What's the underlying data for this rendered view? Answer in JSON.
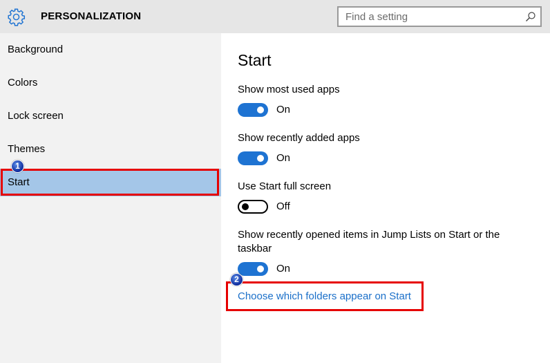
{
  "header": {
    "title": "PERSONALIZATION",
    "icon": "gear-icon",
    "search": {
      "placeholder": "Find a setting",
      "value": "",
      "icon": "search-icon"
    }
  },
  "sidebar": {
    "items": [
      {
        "label": "Background",
        "selected": false
      },
      {
        "label": "Colors",
        "selected": false
      },
      {
        "label": "Lock screen",
        "selected": false
      },
      {
        "label": "Themes",
        "selected": false
      },
      {
        "label": "Start",
        "selected": true
      }
    ],
    "selected_color": "#a4c6e8"
  },
  "main": {
    "title": "Start",
    "settings": [
      {
        "label": "Show most used apps",
        "state": "On",
        "on": true
      },
      {
        "label": "Show recently added apps",
        "state": "On",
        "on": true
      },
      {
        "label": "Use Start full screen",
        "state": "Off",
        "on": false
      },
      {
        "label": "Show recently opened items in Jump Lists on Start or the taskbar",
        "state": "On",
        "on": true
      }
    ],
    "link": "Choose which folders appear on Start",
    "accent_color": "#1e73d2"
  },
  "annotations": {
    "badge1": "1",
    "badge2": "2",
    "highlight_color": "#e60000"
  }
}
